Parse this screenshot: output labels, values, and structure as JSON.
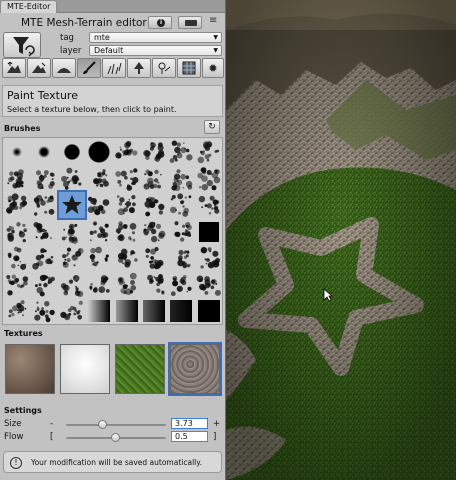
{
  "window": {
    "tab_label": "MTE-Editor"
  },
  "header": {
    "title": "MTE Mesh-Terrain editor",
    "info_icon": "info-icon",
    "keyboard_icon": "keyboard-icon",
    "menu_icon": "menu-icon"
  },
  "selectors": {
    "tag_label": "tag",
    "tag_value": "mte",
    "layer_label": "layer",
    "layer_value": "Default"
  },
  "toolbar": {
    "tools": [
      "raise-lower-icon",
      "paint-height-icon",
      "smooth-icon",
      "paint-texture-icon",
      "grass-icon",
      "tree-icon",
      "flower-icon",
      "grid-icon",
      "settings-icon"
    ],
    "active_index": 3
  },
  "mode": {
    "title": "Paint Texture",
    "description": "Select a texture below, then click to paint."
  },
  "brushes": {
    "label": "Brushes",
    "selected_index": 18
  },
  "textures": {
    "label": "Textures",
    "items": [
      "rock",
      "snow",
      "grass",
      "gravel"
    ],
    "selected_index": 3
  },
  "settings": {
    "label": "Settings",
    "size": {
      "label": "Size",
      "min_marker": "-",
      "max_marker": "+",
      "value": "3.73",
      "fraction": 0.37
    },
    "flow": {
      "label": "Flow",
      "min_marker": "[",
      "max_marker": "]",
      "value": "0.5",
      "fraction": 0.5
    }
  },
  "notice": {
    "text": "Your modification will be saved automatically."
  },
  "colors": {
    "panel_bg": "#c2c2c2",
    "selection_blue": "#3f6fb2",
    "focus_blue": "#3b7de0",
    "grass_green": "#3f6a1f"
  }
}
